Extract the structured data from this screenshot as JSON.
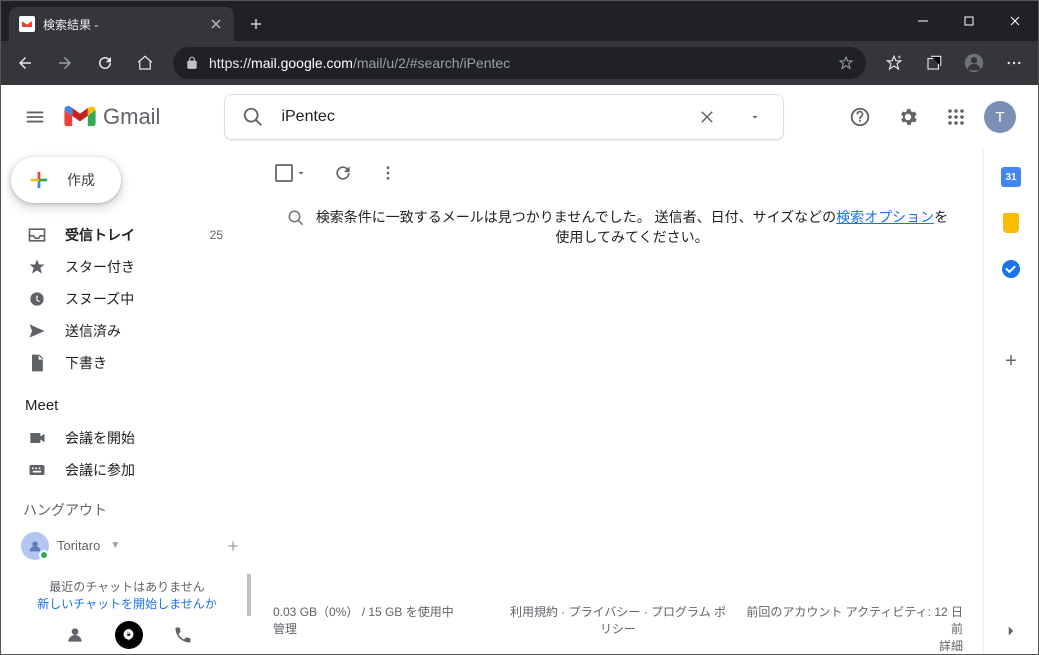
{
  "browser": {
    "tab_title": "検索結果 -",
    "url_protocol": "https://",
    "url_domain": "mail.google.com",
    "url_path": "/mail/u/2/#search/iPentec"
  },
  "header": {
    "logo_text": "Gmail",
    "search_value": "iPentec",
    "avatar_letter": "T"
  },
  "sidebar": {
    "compose": "作成",
    "items": [
      {
        "label": "受信トレイ",
        "count": "25"
      },
      {
        "label": "スター付き"
      },
      {
        "label": "スヌーズ中"
      },
      {
        "label": "送信済み"
      },
      {
        "label": "下書き"
      }
    ],
    "meet_title": "Meet",
    "meet_items": [
      {
        "label": "会議を開始"
      },
      {
        "label": "会議に参加"
      }
    ],
    "hangouts_title": "ハングアウト",
    "hangouts_user": "Toritaro",
    "chat_empty_l1": "最近のチャットはありません",
    "chat_empty_l2": "新しいチャットを開始しませんか"
  },
  "main": {
    "no_results_prefix": "検索条件に一致するメールは見つかりませんでした。 送信者、日付、サイズなどの",
    "no_results_link": "検索オプション",
    "no_results_suffix": "を使用してみてください。"
  },
  "footer": {
    "storage_l1": "0.03 GB（0%） / 15 GB を使用中",
    "storage_l2": "管理",
    "policies": "利用規約 · プライバシー · プログラム ポリシー",
    "activity_l1": "前回のアカウント アクティビティ: 12 日前",
    "activity_l2": "詳細"
  },
  "rightbar": {
    "calendar_day": "31"
  }
}
